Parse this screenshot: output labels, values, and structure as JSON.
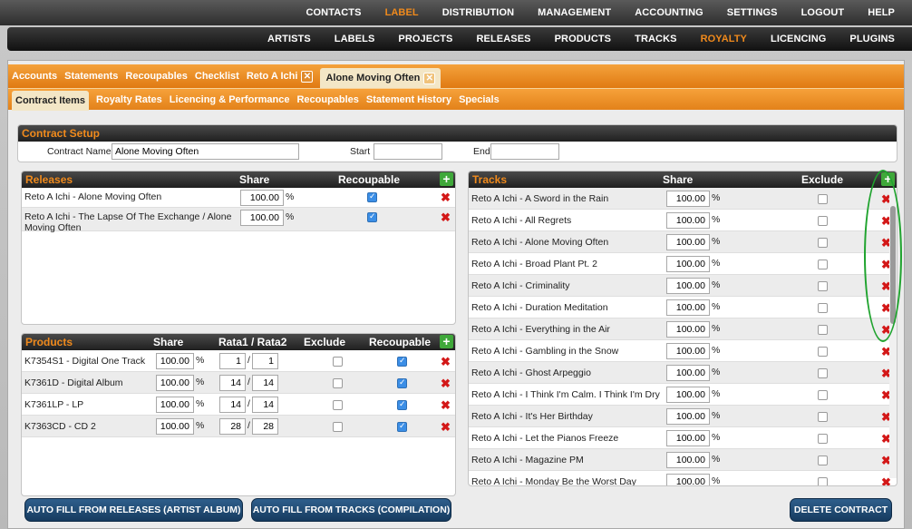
{
  "nav_primary": [
    "CONTACTS",
    "LABEL",
    "DISTRIBUTION",
    "MANAGEMENT",
    "ACCOUNTING",
    "SETTINGS",
    "LOGOUT",
    "HELP"
  ],
  "nav_primary_active": "LABEL",
  "nav_secondary": [
    "ARTISTS",
    "LABELS",
    "PROJECTS",
    "RELEASES",
    "PRODUCTS",
    "TRACKS",
    "ROYALTY",
    "LICENCING",
    "PLUGINS"
  ],
  "nav_secondary_active": "ROYALTY",
  "tabs_top": [
    "Accounts",
    "Statements",
    "Recoupables",
    "Checklist",
    "Reto A Ichi",
    "Alone Moving Often"
  ],
  "tabs_sub": [
    "Contract Items",
    "Royalty Rates",
    "Licencing & Performance",
    "Recoupables",
    "Statement History",
    "Specials"
  ],
  "setup": {
    "title": "Contract Setup",
    "name_label": "Contract Name",
    "name_value": "Alone Moving Often",
    "start_label": "Start",
    "start_value": "",
    "end_label": "End",
    "end_value": ""
  },
  "releases": {
    "title": "Releases",
    "col_share": "Share",
    "col_recoup": "Recoupable",
    "rows": [
      {
        "name": "Reto A Ichi - Alone Moving Often",
        "share": "100.00",
        "recoup": true
      },
      {
        "name": "Reto A Ichi - The Lapse Of The Exchange / Alone Moving Often",
        "share": "100.00",
        "recoup": true
      }
    ]
  },
  "products": {
    "title": "Products",
    "col_share": "Share",
    "col_rata": "Rata1 / Rata2",
    "col_exclude": "Exclude",
    "col_recoup": "Recoupable",
    "rows": [
      {
        "name": "K7354S1 - Digital One Track",
        "share": "100.00",
        "r1": "1",
        "r2": "1",
        "exclude": false,
        "recoup": true
      },
      {
        "name": "K7361D - Digital Album",
        "share": "100.00",
        "r1": "14",
        "r2": "14",
        "exclude": false,
        "recoup": true
      },
      {
        "name": "K7361LP - LP",
        "share": "100.00",
        "r1": "14",
        "r2": "14",
        "exclude": false,
        "recoup": true
      },
      {
        "name": "K7363CD - CD 2",
        "share": "100.00",
        "r1": "28",
        "r2": "28",
        "exclude": false,
        "recoup": true
      }
    ]
  },
  "tracks": {
    "title": "Tracks",
    "col_share": "Share",
    "col_exclude": "Exclude",
    "rows": [
      {
        "name": "Reto A Ichi - A Sword in the Rain",
        "share": "100.00"
      },
      {
        "name": "Reto A Ichi - All Regrets",
        "share": "100.00"
      },
      {
        "name": "Reto A Ichi - Alone Moving Often",
        "share": "100.00"
      },
      {
        "name": "Reto A Ichi - Broad Plant Pt. 2",
        "share": "100.00"
      },
      {
        "name": "Reto A Ichi - Criminality",
        "share": "100.00"
      },
      {
        "name": "Reto A Ichi - Duration Meditation",
        "share": "100.00"
      },
      {
        "name": "Reto A Ichi - Everything in the Air",
        "share": "100.00"
      },
      {
        "name": "Reto A Ichi - Gambling in the Snow",
        "share": "100.00"
      },
      {
        "name": "Reto A Ichi - Ghost Arpeggio",
        "share": "100.00"
      },
      {
        "name": "Reto A Ichi - I Think I'm Calm. I Think I'm Dry",
        "share": "100.00"
      },
      {
        "name": "Reto A Ichi - It's Her Birthday",
        "share": "100.00"
      },
      {
        "name": "Reto A Ichi - Let the Pianos Freeze",
        "share": "100.00"
      },
      {
        "name": "Reto A Ichi - Magazine PM",
        "share": "100.00"
      },
      {
        "name": "Reto A Ichi - Monday Be the Worst Day",
        "share": "100.00"
      }
    ]
  },
  "buttons": {
    "autofill_releases": "AUTO FILL FROM RELEASES (ARTIST ALBUM)",
    "autofill_tracks": "AUTO FILL FROM TRACKS (COMPILATION)",
    "delete": "DELETE CONTRACT"
  },
  "symbols": {
    "percent": "%",
    "slash": "/",
    "plus": "+",
    "close": "✕",
    "delete": "✖"
  }
}
